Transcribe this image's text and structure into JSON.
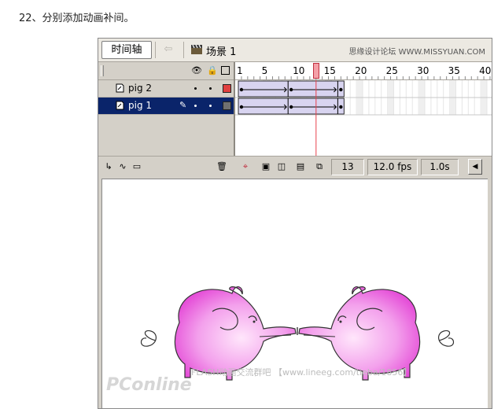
{
  "caption": "22、分别添加动画补间。",
  "toolbar": {
    "tab_label": "时间轴",
    "back_icon": "back-arrow-icon",
    "scene_label": "场景 1",
    "watermark": "思缘设计论坛  WWW.MISSYUAN.COM"
  },
  "ruler": {
    "labels": [
      "1",
      "5",
      "10",
      "15",
      "20",
      "25",
      "30",
      "35",
      "40"
    ],
    "current_frame": 13
  },
  "layers": [
    {
      "name": "pig 2",
      "color": "#e04040",
      "selected": false
    },
    {
      "name": "pig 1",
      "color": "#707070",
      "selected": true
    }
  ],
  "status": {
    "frame": "13",
    "fps": "12.0 fps",
    "time": "1.0s"
  },
  "colors": {
    "tween_fill": "#d8d4f0",
    "playhead": "#e8404c",
    "pig_pink": "#ee72e0",
    "selection": "#0a246a"
  },
  "watermark_bottom": {
    "text": "FLASH动画交流群吧 【www.lineeg.com/tieba/1856】",
    "logo": "PConline"
  }
}
